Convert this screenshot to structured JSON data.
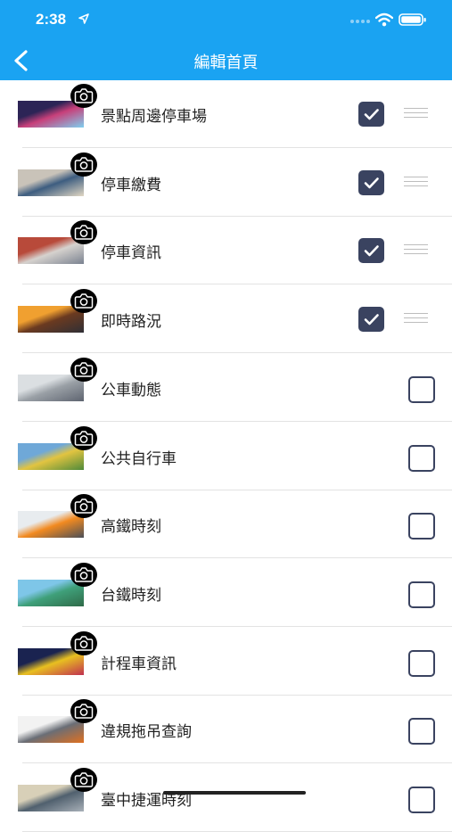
{
  "status": {
    "time": "2:38"
  },
  "nav": {
    "title": "編輯首頁"
  },
  "items": [
    {
      "label": "景點周邊停車場",
      "checked": true,
      "draggable": true,
      "thumb": [
        "#2c2456",
        "#c8407a",
        "#7fd0f0"
      ]
    },
    {
      "label": "停車繳費",
      "checked": true,
      "draggable": true,
      "thumb": [
        "#c9c3b9",
        "#3d5d80",
        "#e2d8c4"
      ]
    },
    {
      "label": "停車資訊",
      "checked": true,
      "draggable": true,
      "thumb": [
        "#b84a3a",
        "#d6d2ce",
        "#7a8290"
      ]
    },
    {
      "label": "即時路況",
      "checked": true,
      "draggable": true,
      "thumb": [
        "#f0a030",
        "#6b3a20",
        "#2f2f35"
      ]
    },
    {
      "label": "公車動態",
      "checked": false,
      "draggable": false,
      "thumb": [
        "#dbdfe2",
        "#9aa0a6",
        "#5e6470"
      ]
    },
    {
      "label": "公共自行車",
      "checked": false,
      "draggable": false,
      "thumb": [
        "#6fa8d8",
        "#e2c440",
        "#4f8a3a"
      ]
    },
    {
      "label": "高鐵時刻",
      "checked": false,
      "draggable": false,
      "thumb": [
        "#e8ecef",
        "#f28a20",
        "#4a4f58"
      ]
    },
    {
      "label": "台鐵時刻",
      "checked": false,
      "draggable": false,
      "thumb": [
        "#7ec6e8",
        "#3fa07a",
        "#2f6a48"
      ]
    },
    {
      "label": "計程車資訊",
      "checked": false,
      "draggable": false,
      "thumb": [
        "#1a2350",
        "#e8c020",
        "#c03050"
      ]
    },
    {
      "label": "違規拖吊查詢",
      "checked": false,
      "draggable": false,
      "thumb": [
        "#f2f2f2",
        "#6a6e76",
        "#e07020"
      ]
    },
    {
      "label": "臺中捷運時刻",
      "checked": false,
      "draggable": false,
      "thumb": [
        "#d8d0b8",
        "#50606e",
        "#a8b0b8"
      ]
    }
  ],
  "colors": {
    "accent": "#1aa3f2",
    "checkbox": "#3a4360"
  },
  "icons": {
    "back": "chevron-left-icon",
    "camera": "camera-icon",
    "check": "checkmark-icon",
    "drag": "drag-handle-icon"
  }
}
